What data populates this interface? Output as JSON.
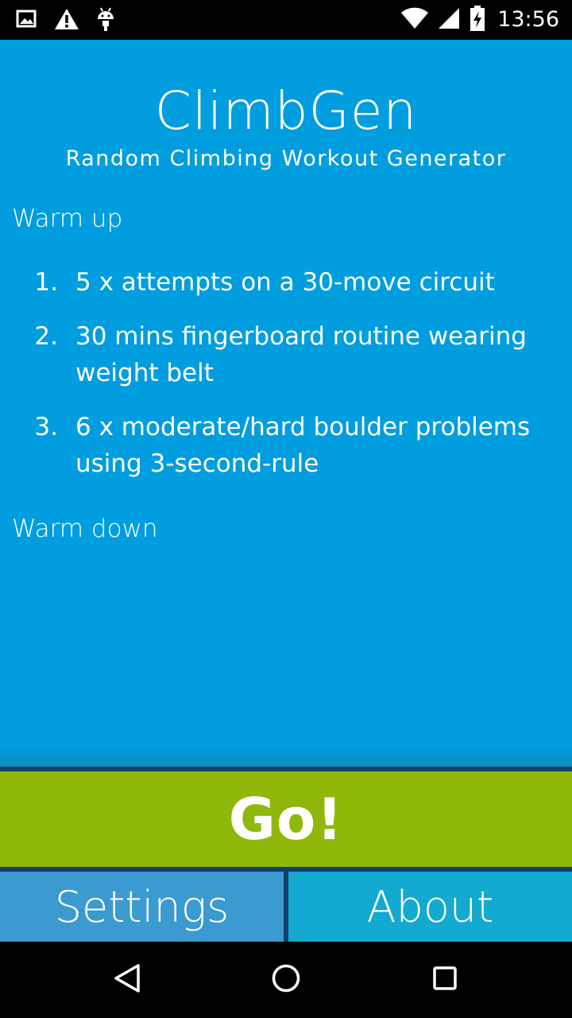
{
  "status_bar": {
    "time": "13:56",
    "left_icons": [
      "image-notification-icon",
      "warning-icon",
      "android-debug-icon"
    ],
    "right_icons": [
      "wifi-icon",
      "cell-signal-icon",
      "battery-charging-icon"
    ]
  },
  "header": {
    "title": "ClimbGen",
    "subtitle": "Random Climbing Workout Generator"
  },
  "workout": {
    "warmup_label": "Warm up",
    "items": [
      {
        "number": "1.",
        "text": "5 x attempts on a 30-move circuit"
      },
      {
        "number": "2.",
        "text": "30 mins fingerboard routine wearing weight belt"
      },
      {
        "number": "3.",
        "text": "6 x moderate/hard boulder problems using 3-second-rule"
      }
    ],
    "warmdown_label": "Warm down"
  },
  "actions": {
    "go_label": "Go!",
    "settings_label": "Settings",
    "about_label": "About"
  },
  "colors": {
    "main_background": "#009ddf",
    "go_button": "#8fb80a",
    "settings_button": "#3b9ad0",
    "about_button": "#13a9d0",
    "divider": "#134063"
  },
  "nav_bar": {
    "icons": [
      "back-icon",
      "home-icon",
      "recents-icon"
    ]
  }
}
